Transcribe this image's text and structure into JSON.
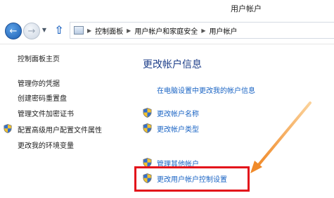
{
  "window": {
    "title": "用户帐户"
  },
  "nav": {
    "back_icon": "back-arrow-icon",
    "forward_icon": "forward-arrow-icon",
    "recent_icon": "chevron-down-icon",
    "up_icon": "up-arrow-icon"
  },
  "address": {
    "breadcrumbs": [
      "控制面板",
      "用户帐户和家庭安全",
      "用户帐户"
    ]
  },
  "sidebar": {
    "items": [
      {
        "label": "控制面板主页"
      },
      {
        "label": "管理你的凭据"
      },
      {
        "label": "创建密码重置盘"
      },
      {
        "label": "管理文件加密证书"
      },
      {
        "label": "配置高级用户配置文件属性"
      },
      {
        "label": "更改我的环境变量"
      }
    ]
  },
  "main": {
    "title": "更改帐户信息",
    "links": [
      {
        "label": "在电脑设置中更改我的帐户信息"
      },
      {
        "label": "更改帐户名称"
      },
      {
        "label": "更改帐户类型"
      },
      {
        "label": "管理其他帐户"
      },
      {
        "label": "更改用户帐户控制设置"
      }
    ]
  },
  "colors": {
    "link": "#1a64c4",
    "title": "#1e3f8a",
    "highlight": "#e3141b",
    "arrow": "#f39a3b"
  }
}
